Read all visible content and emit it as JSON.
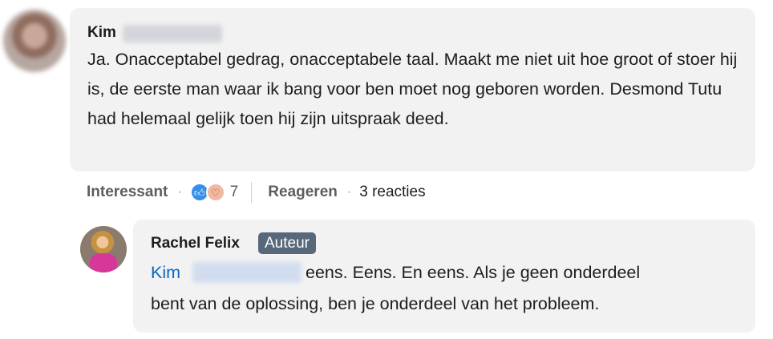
{
  "comment": {
    "author": "Kim",
    "text": "Ja. Onacceptabel gedrag, onacceptabele taal. Maakt me niet uit hoe groot of stoer hij is, de eerste man waar ik bang voor ben moet nog geboren worden. Desmond Tutu had helemaal gelijk toen hij zijn uitspraak deed.",
    "actions": {
      "react_label": "Interessant",
      "reaction_icons": [
        "thumbs-up-icon",
        "heart-icon"
      ],
      "reaction_count": "7",
      "reply_label": "Reageren",
      "replies_count": "3 reacties"
    }
  },
  "reply": {
    "author": "Rachel Felix",
    "badge": "Auteur",
    "mention": "Kim",
    "line1": "eens. Eens. En eens. Als je geen onderdeel",
    "line2": "bent van de oplossing, ben je onderdeel van het probleem."
  },
  "colors": {
    "bubble": "#f2f2f2",
    "mention": "#0a66c2",
    "badge": "#56687a",
    "like": "#378fe9"
  }
}
